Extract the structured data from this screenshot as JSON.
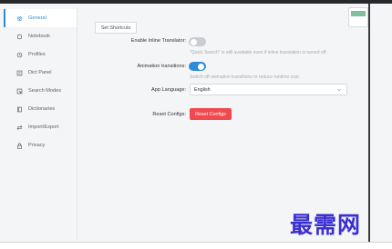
{
  "sidebar": {
    "items": [
      {
        "label": "General",
        "icon": "gear-icon",
        "active": true
      },
      {
        "label": "Notebook",
        "icon": "notebook-icon",
        "active": false
      },
      {
        "label": "Profiles",
        "icon": "profile-icon",
        "active": false
      },
      {
        "label": "Dict Panel",
        "icon": "panel-icon",
        "active": false
      },
      {
        "label": "Search Modes",
        "icon": "search-mode-icon",
        "active": false
      },
      {
        "label": "Dictionaries",
        "icon": "book-icon",
        "active": false
      },
      {
        "label": "Import/Export",
        "icon": "swap-icon",
        "active": false
      },
      {
        "label": "Privacy",
        "icon": "lock-icon",
        "active": false
      }
    ]
  },
  "main": {
    "shortcuts_label": "Set Shortcuts",
    "inline_translator": {
      "label": "Enable Inline Translator:",
      "enabled": false,
      "hint": "\"Quick Search\" is still available even if inline translation is turned off."
    },
    "animation": {
      "label": "Animation transitions:",
      "enabled": true,
      "hint": "Switch off animation transitions to reduce runtime cost."
    },
    "language": {
      "label": "App Language:",
      "value": "English"
    },
    "reset": {
      "label": "Reset Configs:",
      "button": "Reset Configs"
    }
  },
  "watermark": "最需网",
  "colors": {
    "accent": "#2f8bd6",
    "danger": "#f0494f"
  }
}
